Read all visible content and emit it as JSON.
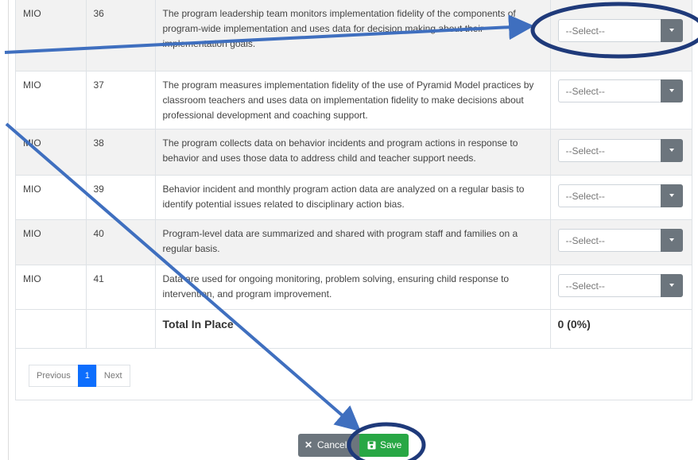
{
  "rows": [
    {
      "code": "MIO",
      "number": "36",
      "text": "The program leadership team monitors implementation fidelity of the components of program-wide implementation and uses data for decision making about their implementation goals.",
      "select": "--Select--"
    },
    {
      "code": "MIO",
      "number": "37",
      "text": "The program measures implementation fidelity of the use of Pyramid Model practices by classroom teachers and uses data on implementation fidelity to make decisions about professional development and coaching support.",
      "select": "--Select--"
    },
    {
      "code": "MIO",
      "number": "38",
      "text": "The program collects data on behavior incidents and program actions in response to behavior and uses those data to address child and teacher support needs.",
      "select": "--Select--"
    },
    {
      "code": "MIO",
      "number": "39",
      "text": "Behavior incident and monthly program action data are analyzed on a regular basis to identify potential issues related to disciplinary action bias.",
      "select": "--Select--"
    },
    {
      "code": "MIO",
      "number": "40",
      "text": "Program-level data are summarized and shared with program staff and families on a regular basis.",
      "select": "--Select--"
    },
    {
      "code": "MIO",
      "number": "41",
      "text": "Data are used for ongoing monitoring, problem solving, ensuring child response to intervention, and program improvement.",
      "select": "--Select--"
    }
  ],
  "total": {
    "label": "Total In Place",
    "value": "0 (0%)"
  },
  "pagination": {
    "previous": "Previous",
    "current": "1",
    "next": "Next"
  },
  "actions": {
    "cancel": "Cancel",
    "save": "Save"
  },
  "icons": {
    "cancel": "times-icon",
    "save": "floppy-disk-icon",
    "dropdown": "caret-down-icon"
  },
  "colors": {
    "annotation": "#1f3a7a",
    "arrow": "#3f6fbf",
    "save_button": "#28a745",
    "cancel_button": "#6c757d",
    "page_active": "#0d6efd",
    "dropdown_button": "#6c757d"
  }
}
